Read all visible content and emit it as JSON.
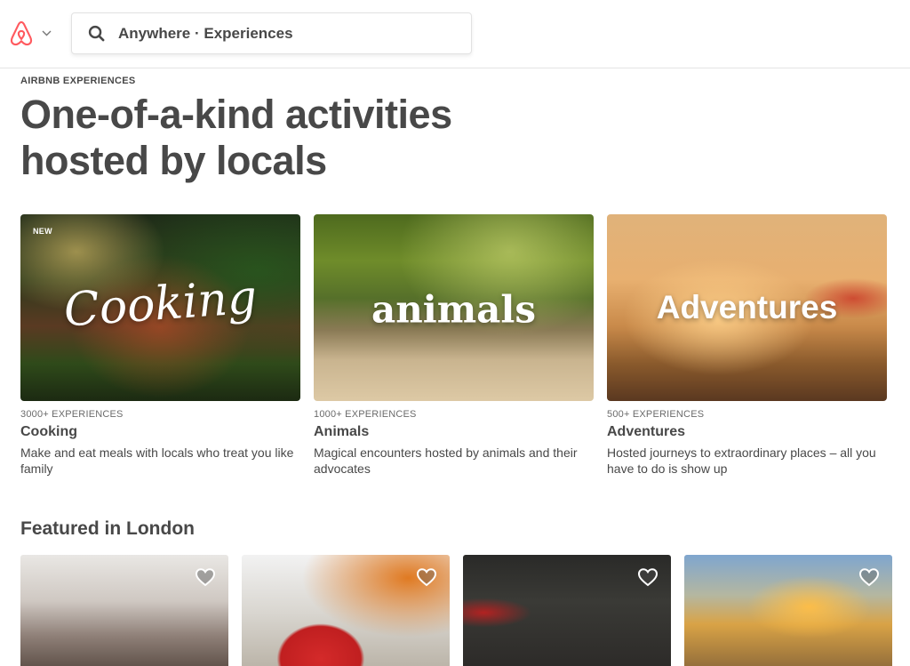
{
  "header": {
    "search_text": "Anywhere · Experiences"
  },
  "hero": {
    "eyebrow": "AIRBNB EXPERIENCES",
    "headline_line1": "One-of-a-kind activities",
    "headline_line2": "hosted by locals"
  },
  "categories": [
    {
      "badge": "NEW",
      "overlay": "Cooking",
      "count": "3000+ EXPERIENCES",
      "name": "Cooking",
      "description": "Make and eat meals with locals who treat you like family"
    },
    {
      "overlay": "animals",
      "count": "1000+ EXPERIENCES",
      "name": "Animals",
      "description": "Magical encounters hosted by animals and their advocates"
    },
    {
      "overlay": "Adventures",
      "count": "500+ EXPERIENCES",
      "name": "Adventures",
      "description": "Hosted journeys to extraordinary places – all you have to do is show up"
    }
  ],
  "featured": {
    "title": "Featured in London",
    "cards": [
      {
        "icon": "heart-icon"
      },
      {
        "icon": "heart-icon"
      },
      {
        "icon": "heart-icon"
      },
      {
        "icon": "heart-icon"
      }
    ]
  },
  "colors": {
    "brand": "#FF5A5F",
    "text": "#484848",
    "muted": "#6b6b6b"
  }
}
